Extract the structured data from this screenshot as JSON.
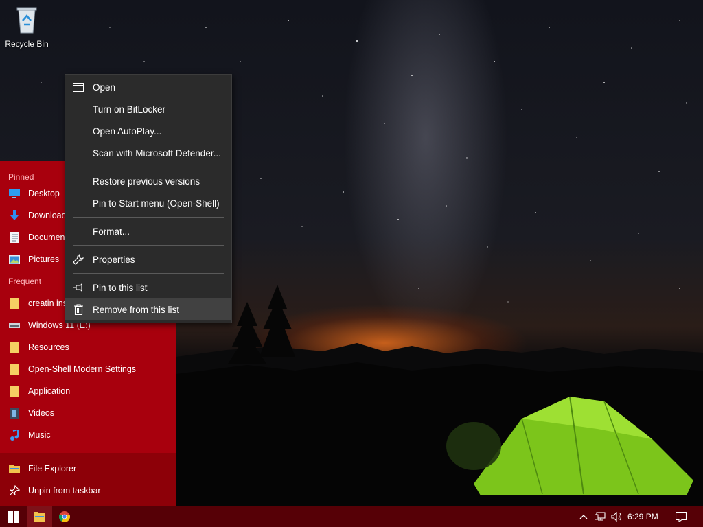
{
  "desktop": {
    "recycle_bin_label": "Recycle Bin"
  },
  "start_menu": {
    "pinned_header": "Pinned",
    "pinned": [
      {
        "label": "Desktop",
        "icon": "desktop-icon"
      },
      {
        "label": "Downloads",
        "icon": "download-arrow-icon"
      },
      {
        "label": "Documents",
        "icon": "document-icon"
      },
      {
        "label": "Pictures",
        "icon": "pictures-icon"
      }
    ],
    "frequent_header": "Frequent",
    "frequent": [
      {
        "label": "creatin ins",
        "icon": "folder-icon"
      },
      {
        "label": "Windows 11 (E:)",
        "icon": "drive-icon"
      },
      {
        "label": "Resources",
        "icon": "folder-icon"
      },
      {
        "label": "Open-Shell Modern Settings",
        "icon": "folder-icon"
      },
      {
        "label": "Application",
        "icon": "folder-icon"
      },
      {
        "label": "Videos",
        "icon": "videos-icon"
      },
      {
        "label": "Music",
        "icon": "music-note-icon"
      }
    ],
    "bottom": [
      {
        "label": "File Explorer",
        "icon": "file-explorer-icon"
      },
      {
        "label": "Unpin from taskbar",
        "icon": "unpin-icon"
      }
    ]
  },
  "context_menu": {
    "items": [
      {
        "label": "Open",
        "icon": "window-icon"
      },
      {
        "label": "Turn on BitLocker"
      },
      {
        "label": "Open AutoPlay..."
      },
      {
        "label": "Scan with Microsoft Defender..."
      },
      {
        "label": "Restore previous versions"
      },
      {
        "label": "Pin to Start menu (Open-Shell)"
      },
      {
        "label": "Format..."
      },
      {
        "label": "Properties",
        "icon": "wrench-icon"
      },
      {
        "label": "Pin to this list",
        "icon": "pin-icon"
      },
      {
        "label": "Remove from this list",
        "icon": "trash-icon"
      }
    ],
    "highlighted_item": "Remove from this list"
  },
  "taskbar": {
    "clock": "6:29 PM",
    "icons": [
      "windows-start-icon",
      "file-explorer-icon",
      "chrome-icon",
      "chevron-up-icon",
      "network-icon",
      "volume-icon",
      "notification-icon"
    ]
  },
  "colors": {
    "start_menu_bg": "#a8000d",
    "taskbar_bg": "#560006",
    "context_menu_bg": "#2b2b2b"
  }
}
